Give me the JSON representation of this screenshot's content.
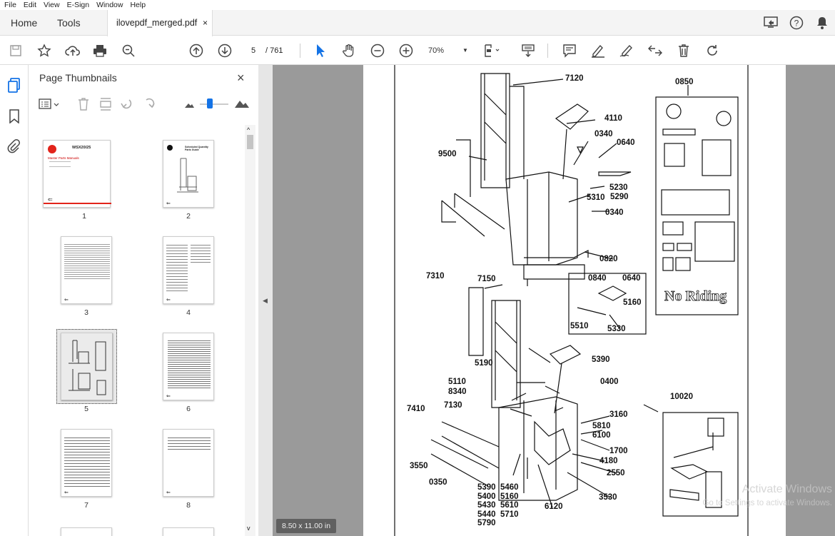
{
  "menu": [
    "File",
    "Edit",
    "View",
    "E-Sign",
    "Window",
    "Help"
  ],
  "tabs": {
    "home": "Home",
    "tools": "Tools",
    "document": "ilovepdf_merged.pdf",
    "close": "×"
  },
  "toolbar": {
    "page_current": "5",
    "page_total": "/ 761",
    "zoom": "70%"
  },
  "panel": {
    "title": "Page Thumbnails",
    "close": "×"
  },
  "thumbnails": [
    "1",
    "2",
    "3",
    "4",
    "5",
    "6",
    "7",
    "8"
  ],
  "thumb1": {
    "title": "WSX20/25",
    "subtitle": "Master Parts Manuals"
  },
  "thumb2": {
    "title": "Scheduled Quantity Parts Guide"
  },
  "page_size": "8.50 x 11.00 in",
  "diagram_labels": {
    "l7120": "7120",
    "l4110": "4110",
    "l0340a": "0340",
    "l0640a": "0640",
    "l9500": "9500",
    "l5230": "5230",
    "l5310": "5310",
    "l5290": "5290",
    "l0340b": "0340",
    "l0820": "0820",
    "l0850": "0850",
    "l7310": "7310",
    "l7150": "7150",
    "l0840": "0840",
    "l0640b": "0640",
    "l5160a": "5160",
    "l5510": "5510",
    "l5330": "5330",
    "l5390a": "5390",
    "l5190": "5190",
    "l0400": "0400",
    "l5110": "5110",
    "l8340": "8340",
    "l7410": "7410",
    "l7130": "7130",
    "l3160": "3160",
    "l5810": "5810",
    "l6100": "6100",
    "l1700": "1700",
    "l4180": "4180",
    "l2550": "2550",
    "l3550": "3550",
    "l0350": "0350",
    "l3530": "3530",
    "l6120": "6120",
    "l10020": "10020",
    "bottom_col1": [
      "5390",
      "5400",
      "5430",
      "5440",
      "5790"
    ],
    "bottom_col2": [
      "5460",
      "5160",
      "5610",
      "5710"
    ],
    "no_riding": "No Riding"
  },
  "watermark": {
    "line1": "Activate Windows",
    "line2": "Go to Settings to activate Windows."
  },
  "colors": {
    "accent": "#1473e6",
    "logo_red": "#e2231a"
  }
}
